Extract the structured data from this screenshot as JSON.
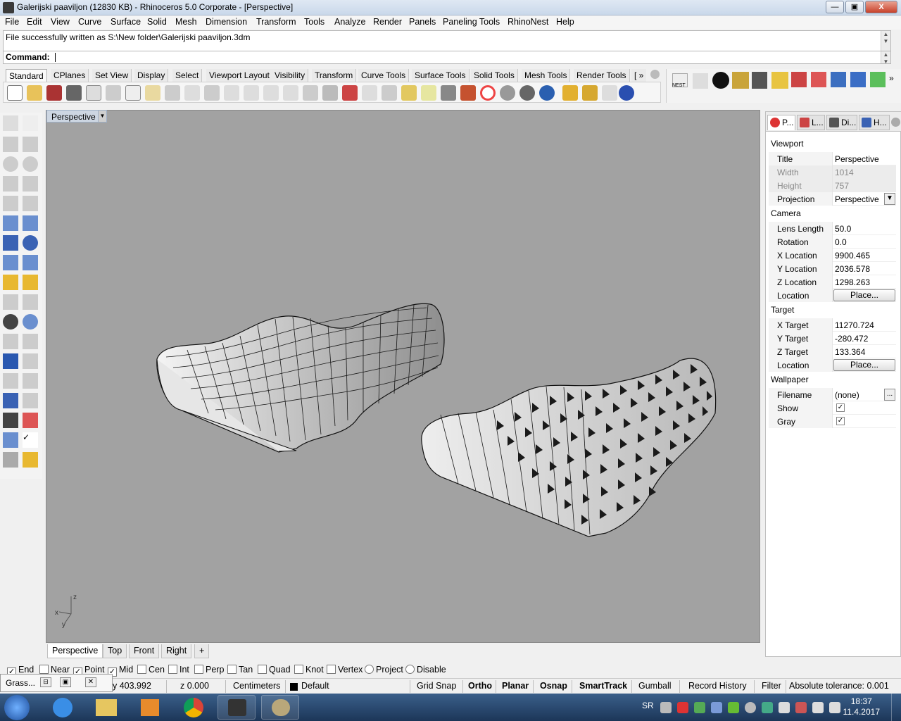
{
  "window": {
    "title": "Galerijski paaviljon (12830 KB) - Rhinoceros  5.0 Corporate - [Perspective]",
    "controls": {
      "minimize": "—",
      "maximize": "▣",
      "close": "X"
    }
  },
  "menu": [
    "File",
    "Edit",
    "View",
    "Curve",
    "Surface",
    "Solid",
    "Mesh",
    "Dimension",
    "Transform",
    "Tools",
    "Analyze",
    "Render",
    "Panels",
    "Paneling Tools",
    "RhinoNest",
    "Help"
  ],
  "command": {
    "history": "File successfully written as S:\\New folder\\Galerijski paaviljon.3dm",
    "label": "Command:"
  },
  "toolbar_tabs": [
    "Standard",
    "CPlanes",
    "Set View",
    "Display",
    "Select",
    "Viewport Layout",
    "Visibility",
    "Transform",
    "Curve Tools",
    "Surface Tools",
    "Solid Tools",
    "Mesh Tools",
    "Render Tools",
    "[ »"
  ],
  "right_toolbar_label": "NEST",
  "viewport": {
    "title": "Perspective",
    "axis": {
      "z": "z",
      "x": "x",
      "y": "y"
    },
    "tabs": [
      "Perspective",
      "Top",
      "Front",
      "Right"
    ],
    "add_tab": "+"
  },
  "properties": {
    "tabs": [
      "P...",
      "L...",
      "Di...",
      "H..."
    ],
    "viewport_section": "Viewport",
    "viewport_rows": [
      {
        "k": "Title",
        "v": "Perspective"
      },
      {
        "k": "Width",
        "v": "1014"
      },
      {
        "k": "Height",
        "v": "757"
      },
      {
        "k": "Projection",
        "v": "Perspective"
      }
    ],
    "camera_section": "Camera",
    "camera_rows": [
      {
        "k": "Lens Length",
        "v": "50.0"
      },
      {
        "k": "Rotation",
        "v": "0.0"
      },
      {
        "k": "X Location",
        "v": "9900.465"
      },
      {
        "k": "Y Location",
        "v": "2036.578"
      },
      {
        "k": "Z Location",
        "v": "1298.263"
      },
      {
        "k": "Location",
        "v": "Place..."
      }
    ],
    "target_section": "Target",
    "target_rows": [
      {
        "k": "X Target",
        "v": "11270.724"
      },
      {
        "k": "Y Target",
        "v": "-280.472"
      },
      {
        "k": "Z Target",
        "v": "133.364"
      },
      {
        "k": "Location",
        "v": "Place..."
      }
    ],
    "wallpaper_section": "Wallpaper",
    "wallpaper_rows": [
      {
        "k": "Filename",
        "v": "(none)",
        "btn": "..."
      },
      {
        "k": "Show",
        "checked": true
      },
      {
        "k": "Gray",
        "checked": true
      }
    ]
  },
  "osnaps": [
    {
      "label": "End",
      "checked": true
    },
    {
      "label": "Near",
      "checked": false
    },
    {
      "label": "Point",
      "checked": true
    },
    {
      "label": "Mid",
      "checked": true
    },
    {
      "label": "Cen",
      "checked": false
    },
    {
      "label": "Int",
      "checked": false
    },
    {
      "label": "Perp",
      "checked": false
    },
    {
      "label": "Tan",
      "checked": false
    },
    {
      "label": "Quad",
      "checked": false
    },
    {
      "label": "Knot",
      "checked": false
    },
    {
      "label": "Vertex",
      "checked": false
    },
    {
      "label": "Project",
      "checked": false
    },
    {
      "label": "Disable",
      "checked": false
    }
  ],
  "status": {
    "grasshopper": "Grass...",
    "y": "y 403.992",
    "z": "z 0.000",
    "units": "Centimeters",
    "layer": "Default",
    "grid_snap": "Grid Snap",
    "ortho": "Ortho",
    "planar": "Planar",
    "osnap": "Osnap",
    "smarttrack": "SmartTrack",
    "gumball": "Gumball",
    "record_history": "Record History",
    "filter": "Filter",
    "tolerance": "Absolute tolerance: 0.001"
  },
  "taskbar": {
    "lang": "SR",
    "time": "18:37",
    "date": "11.4.2017"
  },
  "colors": {
    "viewport_bg": "#a2a2a2",
    "titlebar": "#c9d8ea",
    "taskbar": "#1c3658"
  }
}
